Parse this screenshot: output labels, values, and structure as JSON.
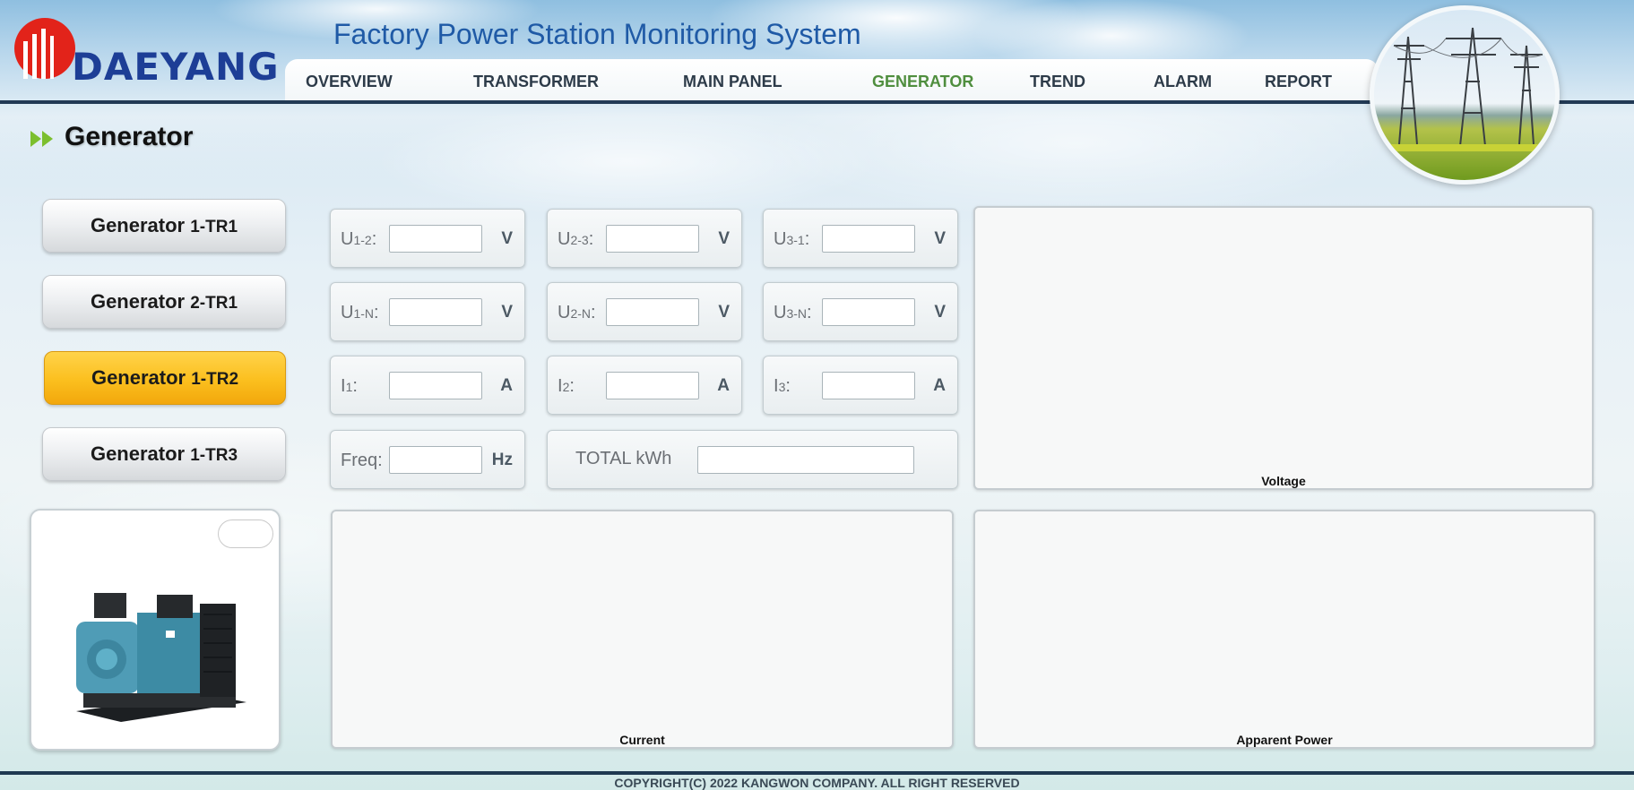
{
  "brand": {
    "logo_text": "DAEYANG",
    "logo_color": "#1d3e96",
    "mark_color": "#e2231a"
  },
  "app_title": "Factory Power Station Monitoring System",
  "nav": {
    "items": [
      {
        "label": "OVERVIEW",
        "active": false
      },
      {
        "label": "TRANSFORMER",
        "active": false
      },
      {
        "label": "MAIN PANEL",
        "active": false
      },
      {
        "label": "GENERATOR",
        "active": true
      },
      {
        "label": "TREND",
        "active": false
      },
      {
        "label": "ALARM",
        "active": false
      },
      {
        "label": "REPORT",
        "active": false
      }
    ],
    "active_color": "#4f8e3e"
  },
  "page_title": "Generator",
  "generators": {
    "items": [
      {
        "name": "Generator",
        "code": "1-TR1",
        "active": false
      },
      {
        "name": "Generator",
        "code": "2-TR1",
        "active": false
      },
      {
        "name": "Generator",
        "code": "1-TR2",
        "active": true
      },
      {
        "name": "Generator",
        "code": "1-TR3",
        "active": false
      }
    ],
    "active_color": "#fbbf1e"
  },
  "readouts": {
    "u12": {
      "label": "U",
      "sub": "1-2",
      "suffix": ":",
      "value": "",
      "unit": "V"
    },
    "u23": {
      "label": "U",
      "sub": "2-3",
      "suffix": ":",
      "value": "",
      "unit": "V"
    },
    "u31": {
      "label": "U",
      "sub": "3-1",
      "suffix": ":",
      "value": "",
      "unit": "V"
    },
    "u1n": {
      "label": "U",
      "sub": "1-N",
      "suffix": ":",
      "value": "",
      "unit": "V"
    },
    "u2n": {
      "label": "U",
      "sub": "2-N",
      "suffix": ":",
      "value": "",
      "unit": "V"
    },
    "u3n": {
      "label": "U",
      "sub": "3-N",
      "suffix": ":",
      "value": "",
      "unit": "V"
    },
    "i1": {
      "label": "I",
      "sub": "1",
      "suffix": ":",
      "value": "",
      "unit": "A"
    },
    "i2": {
      "label": "I",
      "sub": "2",
      "suffix": ":",
      "value": "",
      "unit": "A"
    },
    "i3": {
      "label": "I",
      "sub": "3",
      "suffix": ":",
      "value": "",
      "unit": "A"
    },
    "freq": {
      "label": "Freq:",
      "value": "",
      "unit": "Hz"
    },
    "total_kwh": {
      "label": "TOTAL kWh",
      "value": ""
    }
  },
  "charts": {
    "voltage": "Voltage",
    "current": "Current",
    "apparent_power": "Apparent Power"
  },
  "footer": "COPYRIGHT(C) 2022 KANGWON COMPANY. ALL RIGHT RESERVED"
}
